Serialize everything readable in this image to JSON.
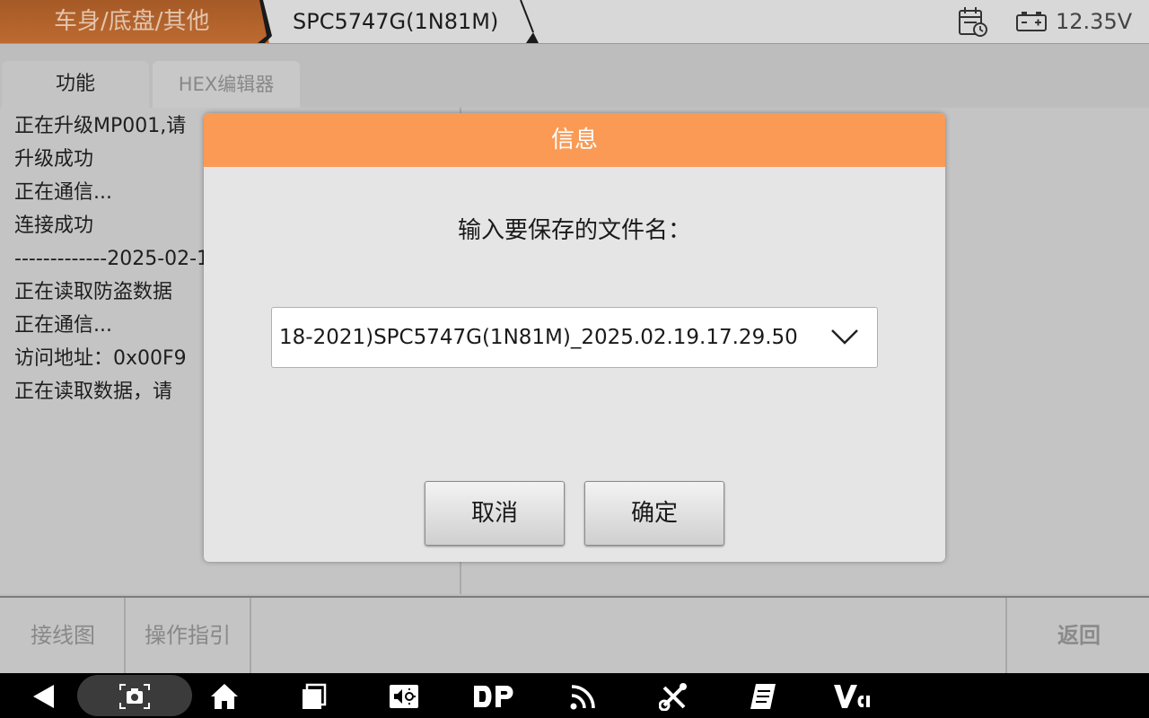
{
  "header": {
    "breadcrumb1": "车身/底盘/其他",
    "breadcrumb2": "SPC5747G(1N81M)",
    "voltage": "12.35V",
    "accent": "#bd6a30"
  },
  "tabs": [
    {
      "label": "功能",
      "active": true
    },
    {
      "label": "HEX编辑器",
      "active": false
    }
  ],
  "log": [
    "正在升级MP001,请",
    "升级成功",
    "正在通信...",
    "连接成功",
    "-------------2025-02-1",
    "正在读取防盗数据",
    "正在通信...",
    "访问地址：0x00F9",
    "正在读取数据，请"
  ],
  "toolbar": {
    "wiring": "接线图",
    "guide": "操作指引",
    "back": "返回"
  },
  "dialog": {
    "title": "信息",
    "prompt": "输入要保存的文件名：",
    "filename": "18-2021)SPC5747G(1N81M)_2025.02.19.17.29.50",
    "cancel": "取消",
    "ok": "确定",
    "title_color": "#fa9a55"
  },
  "navbar": {
    "icons": [
      "back-icon",
      "screenshot-icon",
      "home-icon",
      "recent-apps-icon",
      "volume-icon",
      "dp-icon",
      "signal-icon",
      "tools-icon",
      "notes-icon",
      "vci-icon"
    ]
  }
}
